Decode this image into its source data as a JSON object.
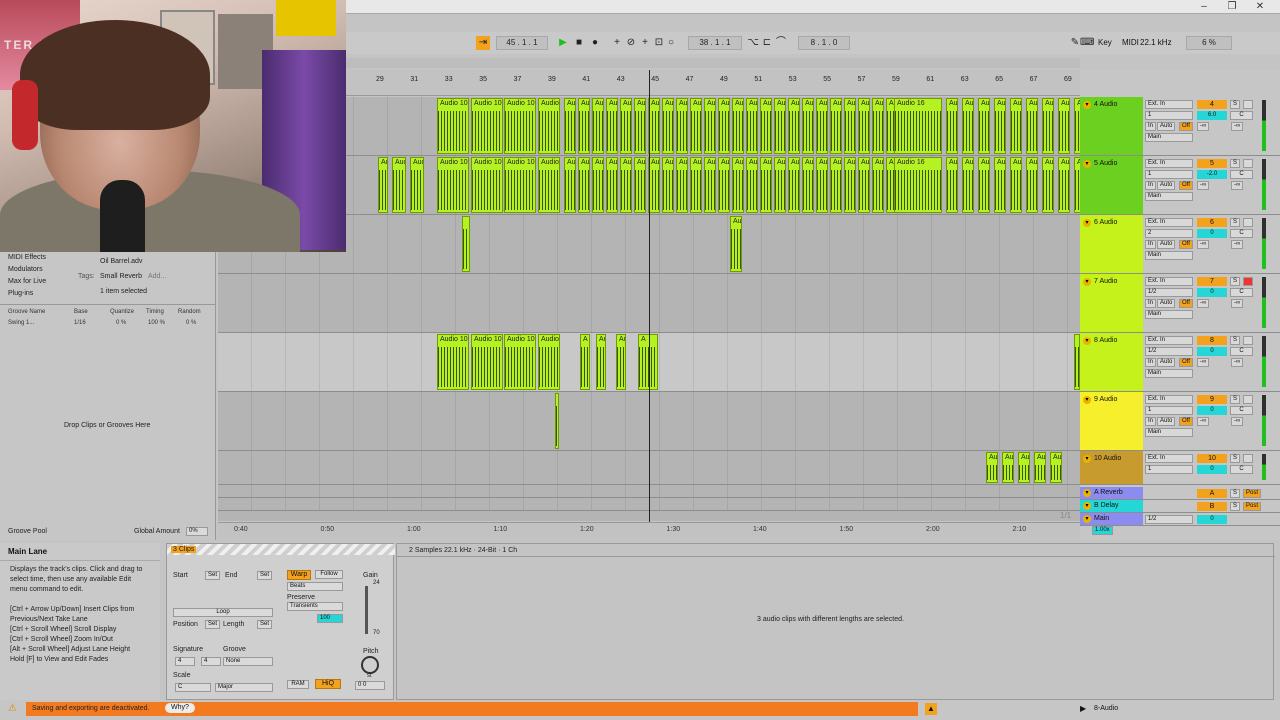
{
  "webcam": {
    "poster_text": "TER MIAM"
  },
  "transport": {
    "position": "45 . 1 . 1",
    "position2": "38 . 1 . 1",
    "loop_len": "8 . 1 . 0",
    "key": "Key",
    "midi": "MIDI",
    "sample_rate": "22.1 kHz",
    "cpu": "6 %"
  },
  "ruler": {
    "bars": [
      "29",
      "31",
      "33",
      "35",
      "37",
      "39",
      "41",
      "43",
      "45",
      "47",
      "49",
      "51",
      "53",
      "55",
      "57",
      "59",
      "61",
      "63",
      "65",
      "67",
      "69"
    ],
    "set_label": "Set"
  },
  "timeline": [
    "0:40",
    "0:50",
    "1:00",
    "1:10",
    "1:20",
    "1:30",
    "1:40",
    "1:50",
    "2:00",
    "2:10"
  ],
  "timeline_page": "1/1",
  "tracks": [
    {
      "name": "4 Audio",
      "num": "4",
      "input": "Ext. In",
      "ch": "1",
      "vol": "6.0",
      "out": "Main",
      "color": "#6bd01f"
    },
    {
      "name": "5 Audio",
      "num": "5",
      "input": "Ext. In",
      "ch": "1",
      "vol": "-2.0",
      "out": "Main",
      "color": "#6bd01f"
    },
    {
      "name": "6 Audio",
      "num": "6",
      "input": "Ext. In",
      "ch": "2",
      "vol": "0",
      "out": "Main",
      "color": "#c6f21c"
    },
    {
      "name": "7 Audio",
      "num": "7",
      "input": "Ext. In",
      "ch": "1/2",
      "vol": "0",
      "out": "Main",
      "color": "#c6f21c"
    },
    {
      "name": "8 Audio",
      "num": "8",
      "input": "Ext. In",
      "ch": "1/2",
      "vol": "0",
      "out": "Main",
      "color": "#c6f21c"
    },
    {
      "name": "9 Audio",
      "num": "9",
      "input": "Ext. In",
      "ch": "1",
      "vol": "0",
      "out": "Main",
      "color": "#f6ef2c"
    },
    {
      "name": "10 Audio",
      "num": "10",
      "input": "Ext. In",
      "ch": "1",
      "vol": "0",
      "out": "Main",
      "color": "#c79b2d"
    }
  ],
  "returns": [
    {
      "name": "A Reverb",
      "letter": "A",
      "post": "Post"
    },
    {
      "name": "B Delay",
      "letter": "B",
      "post": "Post"
    }
  ],
  "main": {
    "name": "Main",
    "ch": "1/2",
    "vol": "0",
    "zoom": "1.00x"
  },
  "mixer_track_controls": {
    "in": "In",
    "auto": "Auto",
    "off": "Off",
    "s": "S",
    "c": "C",
    "neg_inf": "-∞"
  },
  "clips": {
    "audio10": "Audio 10",
    "audio16": "Audio 16",
    "aud": "Aud",
    "au": "Au",
    "a": "A"
  },
  "browser": {
    "items": [
      "MIDI Effects",
      "Modulators",
      "Max for Live",
      "Plug-ins"
    ],
    "file": "Oil Barrel.adv",
    "tags_label": "Tags:",
    "tag": "Small Reverb",
    "add": "Add...",
    "selected": "1 item selected",
    "groove_headers": [
      "Groove Name",
      "Base",
      "Quantize",
      "Timing",
      "Random"
    ],
    "groove_row": {
      "name": "Swing 1...",
      "base": "1/16",
      "quantize": "0 %",
      "timing": "100 %",
      "random": "0 %"
    },
    "drop_hint": "Drop Clips or Grooves Here",
    "pool": "Groove Pool",
    "global_amount_label": "Global Amount",
    "global_amount": "0%"
  },
  "info": {
    "title": "Main Lane",
    "body": "Displays the track's clips. Click and drag to select time, then use any available Edit menu command to edit.",
    "shortcuts": [
      "[Ctrl + Arrow Up/Down] Insert Clips from Previous/Next Take Lane",
      "[Ctrl + Scroll Wheel] Scroll Display",
      "[Ctrl + Scroll Wheel] Zoom In/Out",
      "[Alt + Scroll Wheel] Adjust Lane Height",
      "Hold [F] to View and Edit Fades"
    ]
  },
  "clipview": {
    "title": "3 Clips",
    "start": "Start",
    "end": "End",
    "set": "Set",
    "loop": "Loop",
    "position": "Position",
    "length": "Length",
    "signature": "Signature",
    "sig_num": "4",
    "sig_den": "4",
    "groove": "Groove",
    "groove_val": "None",
    "scale": "Scale",
    "scale_root": "C",
    "scale_mode": "Major",
    "warp": "Warp",
    "follow": "Follow",
    "beats": "Beats",
    "preserve": "Preserve",
    "transients": "Transients",
    "amount": "100",
    "gain": "Gain",
    "gain_top": "24",
    "gain_bottom": "70",
    "pitch": "Pitch",
    "pitch_val": "st",
    "pitch_nums": "0 0",
    "ram": "RAM",
    "hiq": "HiQ"
  },
  "sampleview": {
    "header": "2 Samples  22.1 kHz · 24-Bit · 1 Ch",
    "message": "3 audio clips with different lengths are selected."
  },
  "status": {
    "warning": "Saving and exporting are deactivated.",
    "why": "Why?",
    "track": "8-Audio"
  },
  "colors": {
    "accent": "#f2a21c",
    "clip": "#b5f224",
    "warning": "#f37a21",
    "cyan": "#25d6d6"
  }
}
